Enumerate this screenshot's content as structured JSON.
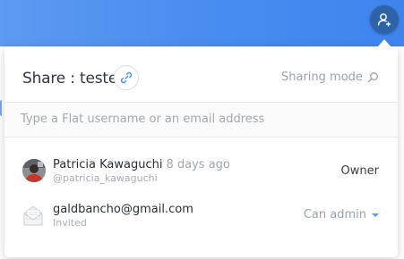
{
  "background": {
    "accent_color": "#4a8cf0",
    "share_toggle_icon": "add-user-icon"
  },
  "share_panel": {
    "title": "Share : teste",
    "link_icon": "link-icon",
    "sharing_mode": {
      "label": "Sharing mode",
      "icon": "search-icon"
    },
    "search": {
      "value": "",
      "placeholder": "Type a Flat username or an email address"
    },
    "members": [
      {
        "name": "Patricia Kawaguchi",
        "when": "8 days ago",
        "sub": "@patricia_kawaguchi",
        "role": "Owner",
        "role_editable": false
      },
      {
        "name": "galdbancho@gmail.com",
        "sub": "Invited",
        "role": "Can admin",
        "role_editable": true,
        "icon": "envelope-icon"
      }
    ]
  }
}
